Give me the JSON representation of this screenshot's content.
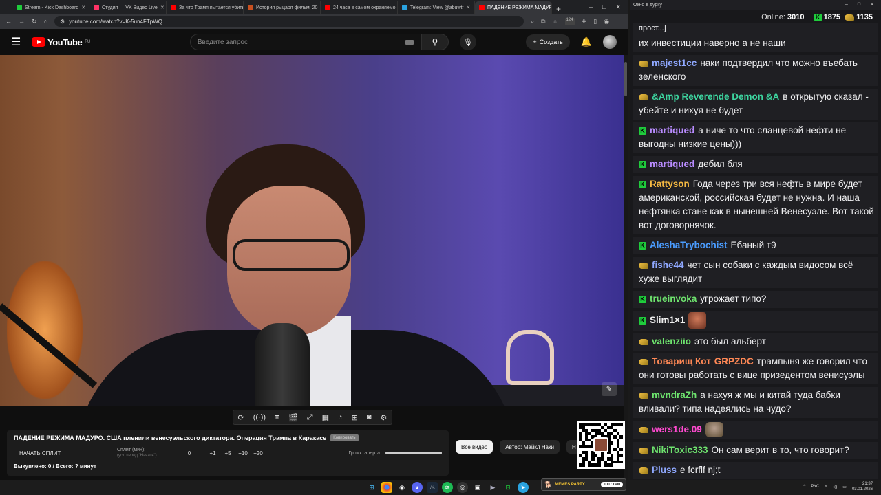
{
  "browser": {
    "tabs": [
      {
        "label": "Stream - Kick Dashboard",
        "color": "#1fcc3c",
        "active": false
      },
      {
        "label": "Студия — VK Видео Live",
        "color": "#ff3366",
        "active": false
      },
      {
        "label": "За что Трамп пытается убить",
        "color": "#ff0000",
        "active": false
      },
      {
        "label": "История рыцаря фильм, 20",
        "color": "#c85020",
        "active": false
      },
      {
        "label": "24 часа в самом охраняемо",
        "color": "#ff0000",
        "active": false
      },
      {
        "label": "Telegram: View @abuwtf",
        "color": "#2aa3e0",
        "active": false
      },
      {
        "label": "ПАДЕНИЕ РЕЖИМА МАДУРО",
        "color": "#ff0000",
        "active": true
      }
    ],
    "url": "youtube.com/watch?v=K-5un4FTpWQ",
    "ext_badge": "124"
  },
  "youtube": {
    "logo_text": "YouTube",
    "logo_region": "RU",
    "search_placeholder": "Введите запрос",
    "create_label": "Создать",
    "chips": [
      "Все видео",
      "Автор: Майкл Наки",
      "Н"
    ]
  },
  "split": {
    "title": "ПАДЕНИЕ РЕЖИМА МАДУРО. США пленили венесуэльского диктатора. Операция Трампа в Каракасе",
    "copy_label": "Копировать",
    "start_label": "НАЧАТЬ СПЛИТ",
    "minutes_label": "Сплит (мин):",
    "minutes_hint": "(уст. перед \"Начать\")",
    "value": "0",
    "increments": [
      "+1",
      "+5",
      "+10",
      "+20"
    ],
    "alert_volume_label": "Громк. алерта:",
    "bought_text": "Выкуплено: 0 / Всего: ? минут"
  },
  "chat": {
    "window_title": "Окно в дурку",
    "online_label": "Online:",
    "online_count": "3010",
    "kick_count": "1875",
    "gold_count": "1135",
    "colors": {
      "kick_green": "#1fcc3c",
      "gold": "#f3c244"
    },
    "partial_top": "прост...]",
    "messages": [
      {
        "badge": "none",
        "name": "",
        "color": "#fff",
        "text": "их инвестиции наверно а не наши"
      },
      {
        "badge": "gold",
        "name": "majest1cc",
        "color": "#8fa8ff",
        "text": "наки подтвердил что можно въебать зеленского"
      },
      {
        "badge": "gold",
        "name": "&Amp Reverende Demon &A",
        "color": "#3dd6a0",
        "text": "в открытую сказал - убейте и нихуя не будет"
      },
      {
        "badge": "kick",
        "name": "martiqued",
        "color": "#b98cff",
        "text": "а ниче то что сланцевой нефти не выгодны низкие цены)))"
      },
      {
        "badge": "kick",
        "name": "martiqued",
        "color": "#b98cff",
        "text": "дебил бля"
      },
      {
        "badge": "kick",
        "name": "Rattyson",
        "color": "#f5b942",
        "text": "Года через три вся нефть в мире будет американской, российская будет не нужна. И наша нефтянка стане как в нынешней Венесуэле. Вот такой вот договорнячок."
      },
      {
        "badge": "kick",
        "name": "AleshaTrybochist",
        "color": "#4a9cff",
        "text": "Ебаный т9"
      },
      {
        "badge": "gold",
        "name": "fishe44",
        "color": "#8fa8ff",
        "text": "чет сын собаки с каждым видосом всё хуже выглядит"
      },
      {
        "badge": "kick",
        "name": "trueinvoka",
        "color": "#6ee36e",
        "text": "угрожает типо?"
      },
      {
        "badge": "kick",
        "name": "Slim1×1",
        "color": "#f0f0f0",
        "text": "",
        "emote": "emote"
      },
      {
        "badge": "gold",
        "name": "valenziio",
        "color": "#6ee36e",
        "text": "это был альберт"
      },
      {
        "badge": "gold",
        "name": "Товарищ Кот",
        "color": "#ff8855",
        "text": "трампыня же говорил что они готовы работать с вице призедентом венисуэлы",
        "tag": "GRPZDC"
      },
      {
        "badge": "gold",
        "name": "mvndraZh",
        "color": "#6ee36e",
        "text": "а нахуя ж мы и китай туда бабки вливали? типа надеялись на чудо?"
      },
      {
        "badge": "gold",
        "name": "wers1de.09",
        "color": "#ff4ad0",
        "text": "",
        "emote": "emote2"
      },
      {
        "badge": "gold",
        "name": "NikiToxic333",
        "color": "#6ee36e",
        "text": "Он сам верит в то, что говорит?"
      },
      {
        "badge": "gold",
        "name": "Pluss",
        "color": "#8fa8ff",
        "text": "е fcrflf nj;t"
      }
    ]
  },
  "taskbar": {
    "memes_label": "MEMES PARTY",
    "memes_progress": "100 / 1500",
    "lang": "РУС",
    "time": "21:37",
    "date": "03.01.2026"
  }
}
